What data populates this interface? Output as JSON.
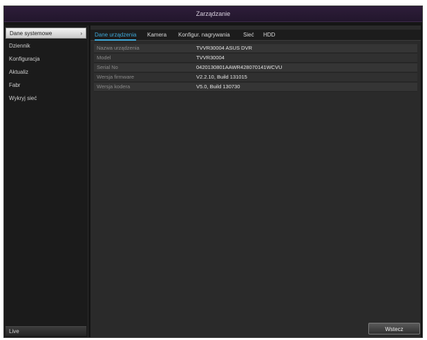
{
  "window": {
    "title": "Zarządzanie"
  },
  "sidebar": {
    "items": [
      {
        "label": "Dane systemowe",
        "active": true
      },
      {
        "label": "Dziennik",
        "active": false
      },
      {
        "label": "Konfiguracja",
        "active": false
      },
      {
        "label": "Aktualiz",
        "active": false
      },
      {
        "label": "Fabr",
        "active": false
      },
      {
        "label": "Wykryj sieć",
        "active": false
      }
    ],
    "active_chevron": "›",
    "exit_label": "Live"
  },
  "tabs": [
    {
      "label": "Dane urządzenia",
      "active": true
    },
    {
      "label": "Kamera",
      "active": false
    },
    {
      "label": "Konfigur. nagrywania",
      "active": false
    },
    {
      "label": "Sieć",
      "active": false
    },
    {
      "label": "HDD",
      "active": false
    }
  ],
  "device_info": [
    {
      "label": "Nazwa urządzenia",
      "value": "TVVR30004 ASUS DVR"
    },
    {
      "label": "Model",
      "value": "TVVR30004"
    },
    {
      "label": "Serial No",
      "value": "0420130801AAWR428070141WCVU"
    },
    {
      "label": "Wersja firmware",
      "value": "V2.2.10, Build 131015"
    },
    {
      "label": "Wersja kodera",
      "value": "V5.0, Build 130730"
    }
  ],
  "footer": {
    "exit_button": "Wstecz"
  },
  "colors": {
    "accent": "#3ea8d8",
    "titlebar": "#2e1d3a",
    "background": "#151515"
  }
}
